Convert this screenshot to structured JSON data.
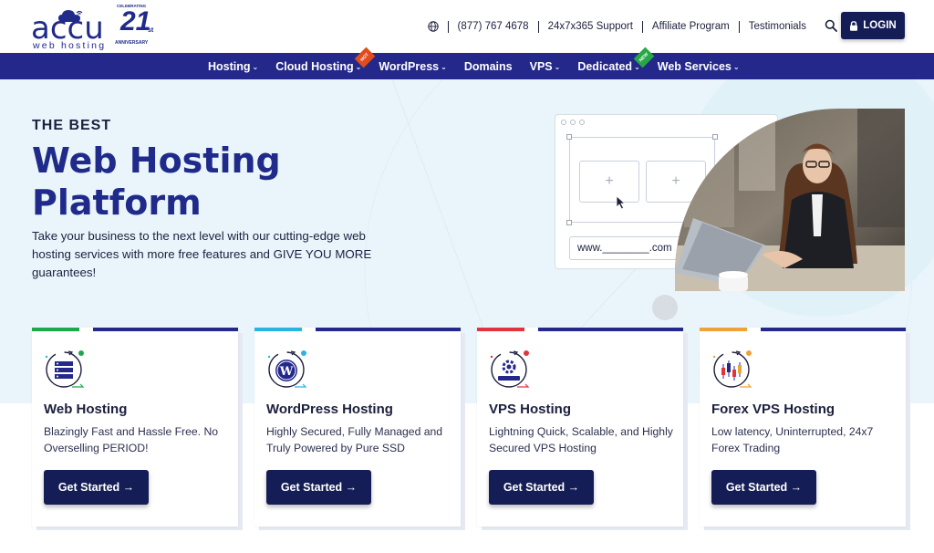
{
  "brand": {
    "logo_text": "accu",
    "logo_subtext": "web hosting",
    "badge_top": "CELEBRATING",
    "badge_number": "21",
    "badge_suffix": "st",
    "badge_bottom": "ANNIVERSARY"
  },
  "topbar": {
    "phone": "(877) 767 4678",
    "support": "24x7x365 Support",
    "affiliate": "Affiliate Program",
    "testimonials": "Testimonials",
    "login_label": "LOGIN"
  },
  "nav": {
    "items": [
      {
        "label": "Hosting",
        "has_dropdown": true,
        "tag": ""
      },
      {
        "label": "Cloud Hosting",
        "has_dropdown": true,
        "tag": "HOT"
      },
      {
        "label": "WordPress",
        "has_dropdown": true,
        "tag": ""
      },
      {
        "label": "Domains",
        "has_dropdown": false,
        "tag": ""
      },
      {
        "label": "VPS",
        "has_dropdown": true,
        "tag": ""
      },
      {
        "label": "Dedicated",
        "has_dropdown": true,
        "tag": "NEW"
      },
      {
        "label": "Web Services",
        "has_dropdown": true,
        "tag": ""
      }
    ],
    "chevron": "⌄"
  },
  "hero": {
    "eyebrow": "THE BEST",
    "title": "Web Hosting Platform",
    "description": "Take your business to the next level with our cutting-edge web hosting services with more free features and GIVE YOU MORE guarantees!",
    "mockup_url": "www.________.com"
  },
  "cards": [
    {
      "title": "Web Hosting",
      "description": "Blazingly Fast and Hassle Free. No Overselling PERIOD!",
      "button": "Get Started →",
      "accent": "#1fa84b",
      "dot": "#1fa84b",
      "icon": "server-icon"
    },
    {
      "title": "WordPress Hosting",
      "description": "Highly Secured, Fully Managed and Truly Powered by Pure SSD",
      "button": "Get Started →",
      "accent": "#2ab4e0",
      "dot": "#2ab4e0",
      "icon": "wordpress-icon"
    },
    {
      "title": "VPS Hosting",
      "description": "Lightning Quick, Scalable, and Highly Secured VPS Hosting",
      "button": "Get Started →",
      "accent": "#e2343d",
      "dot": "#e2343d",
      "icon": "gear-server-icon"
    },
    {
      "title": "Forex VPS Hosting",
      "description": "Low latency, Uninterrupted, 24x7 Forex Trading",
      "button": "Get Started →",
      "accent": "#f0a23a",
      "dot": "#f0a23a",
      "icon": "candlestick-chart-icon"
    }
  ],
  "colors": {
    "primary_navy": "#141d55",
    "nav_blue": "#23288a",
    "hero_bg": "#e9f5fb"
  }
}
